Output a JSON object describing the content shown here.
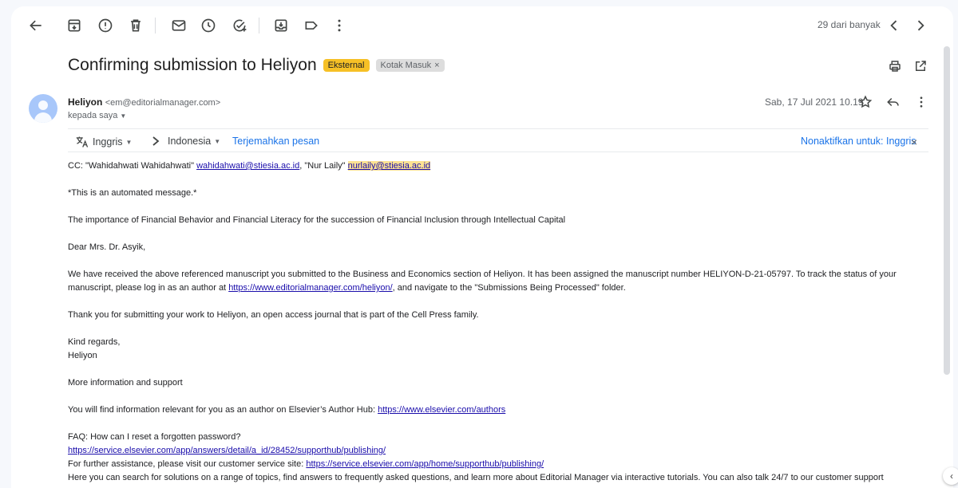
{
  "toolbar": {
    "back_icon": "arrow-left-icon",
    "archive_icon": "archive-icon",
    "report_icon": "report-spam-icon",
    "delete_icon": "trash-icon",
    "unread_icon": "mail-icon",
    "snooze_icon": "clock-icon",
    "task_icon": "add-task-icon",
    "move_icon": "move-to-icon",
    "label_icon": "label-icon",
    "more_icon": "more-vert-icon",
    "pager_text": "29 dari banyak",
    "prev_icon": "chevron-left-icon",
    "next_icon": "chevron-right-icon"
  },
  "email": {
    "subject": "Confirming submission to Heliyon",
    "badge_external": "Eksternal",
    "badge_inbox": "Kotak Masuk",
    "badge_inbox_remove": "×",
    "sender_name": "Heliyon",
    "sender_email": "<em@editorialmanager.com>",
    "to_text": "kepada saya",
    "date": "Sab, 17 Jul 2021 10.19"
  },
  "translate": {
    "from_lang": "Inggris",
    "to_lang": "Indonesia",
    "translate_link": "Terjemahkan pesan",
    "disable_link": "Nonaktifkan untuk: Inggris",
    "close": "×"
  },
  "body": {
    "cc_label": "CC: \"Wahidahwati Wahidahwati\" ",
    "cc_email1": "wahidahwati@stiesia.ac.id",
    "cc_mid": ", \"Nur Laily\" ",
    "cc_email2": "nurlaily@stiesia.ac.id",
    "automated": "*This is an automated message.*",
    "title": "The importance of Financial Behavior and Financial Literacy for the succession of Financial Inclusion through Intellectual Capital",
    "greeting": "Dear Mrs. Dr. Asyik,",
    "para1_a": "We have received the above referenced manuscript you submitted to the Business and Economics section of Heliyon. It has been assigned the manuscript number HELIYON-D-21-05797. To track the status of your manuscript, please log in as an author at ",
    "para1_link": "https://www.editorialmanager.com/heliyon/",
    "para1_b": ", and navigate to the \"Submissions Being Processed\" folder.",
    "thanks": "Thank you for submitting your work to Heliyon, an open access journal that is part of the Cell Press family.",
    "regards": "Kind regards,",
    "sign": "Heliyon",
    "more_info": "More information and support",
    "hub_text": "You will find information relevant for you as an author on Elsevier’s Author Hub: ",
    "hub_link": "https://www.elsevier.com/authors",
    "faq": "FAQ: How can I reset a forgotten password?",
    "faq_link": "https://service.elsevier.com/app/answers/detail/a_id/28452/supporthub/publishing/",
    "assist_text": "For further assistance, please visit our customer service site: ",
    "assist_link": "https://service.elsevier.com/app/home/supporthub/publishing/",
    "search_text": "Here you can search for solutions on a range of topics, find answers to frequently asked questions, and learn more about Editorial Manager via interactive tutorials. You can also talk 24/7 to our customer support"
  }
}
